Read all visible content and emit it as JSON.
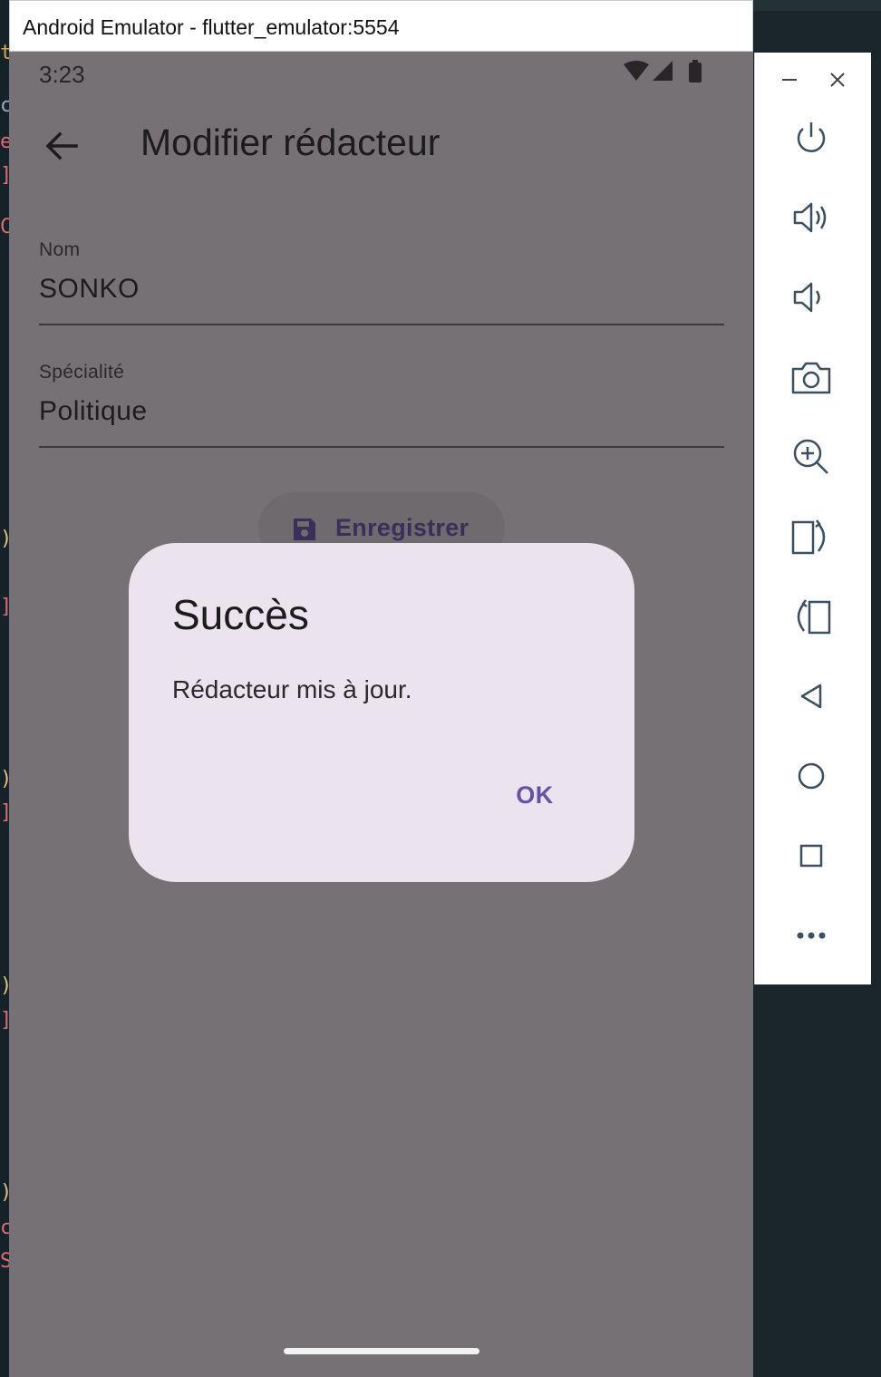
{
  "window": {
    "title": "Android Emulator - flutter_emulator:5554"
  },
  "status_bar": {
    "time": "3:23",
    "icons": [
      "wifi-icon",
      "signal-icon",
      "battery-icon"
    ]
  },
  "app_bar": {
    "back_icon": "arrow-back-icon",
    "title": "Modifier rédacteur"
  },
  "form": {
    "nom": {
      "label": "Nom",
      "value": "SONKO"
    },
    "specialite": {
      "label": "Spécialité",
      "value": "Politique"
    },
    "save_button": {
      "icon": "save-icon",
      "label": "Enregistrer"
    }
  },
  "dialog": {
    "title": "Succès",
    "message": "Rédacteur mis à jour.",
    "ok_label": "OK"
  },
  "emulator_toolbar": {
    "items": [
      "minimize-icon",
      "close-icon",
      "power-icon",
      "volume-up-icon",
      "volume-down-icon",
      "camera-icon",
      "zoom-in-icon",
      "rotate-left-icon",
      "rotate-right-icon",
      "back-icon",
      "home-icon",
      "overview-icon",
      "more-icon"
    ]
  },
  "colors": {
    "scrim": "#767174",
    "dialog_surface": "#ebe3ee",
    "accent": "#6850a4"
  }
}
